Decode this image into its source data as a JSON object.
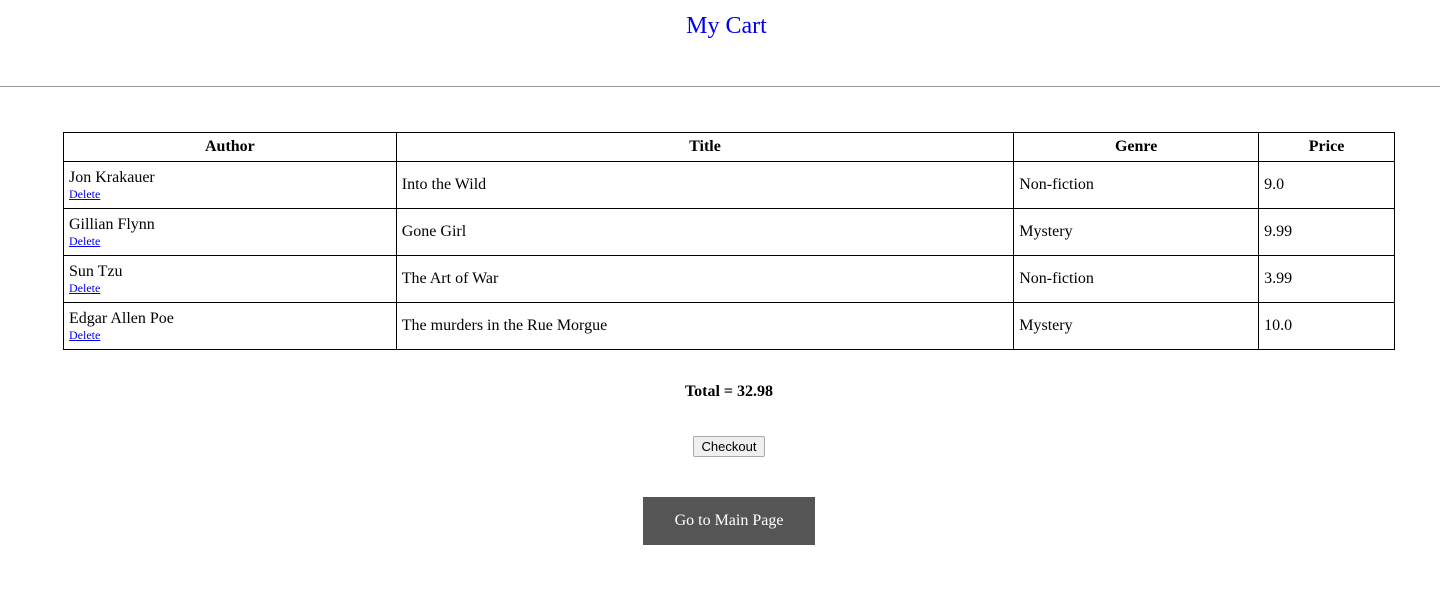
{
  "header": {
    "title": "My Cart"
  },
  "table": {
    "columns": [
      "Author",
      "Title",
      "Genre",
      "Price"
    ],
    "rows": [
      {
        "author": "Jon Krakauer",
        "delete_label": "Delete",
        "title": "Into the Wild",
        "genre": "Non-fiction",
        "price": "9.0"
      },
      {
        "author": "Gillian Flynn",
        "delete_label": "Delete",
        "title": "Gone Girl",
        "genre": "Mystery",
        "price": "9.99"
      },
      {
        "author": "Sun Tzu",
        "delete_label": "Delete",
        "title": "The Art of War",
        "genre": "Non-fiction",
        "price": "3.99"
      },
      {
        "author": "Edgar Allen Poe",
        "delete_label": "Delete",
        "title": "The murders in the Rue Morgue",
        "genre": "Mystery",
        "price": "10.0"
      }
    ]
  },
  "summary": {
    "total_text": "Total = 32.98"
  },
  "actions": {
    "checkout_label": "Checkout",
    "main_page_label": "Go to Main Page"
  },
  "colors": {
    "title": "#0000ee",
    "link": "#0000ee",
    "main_button_bg": "#555555",
    "main_button_text": "#ffffff"
  }
}
